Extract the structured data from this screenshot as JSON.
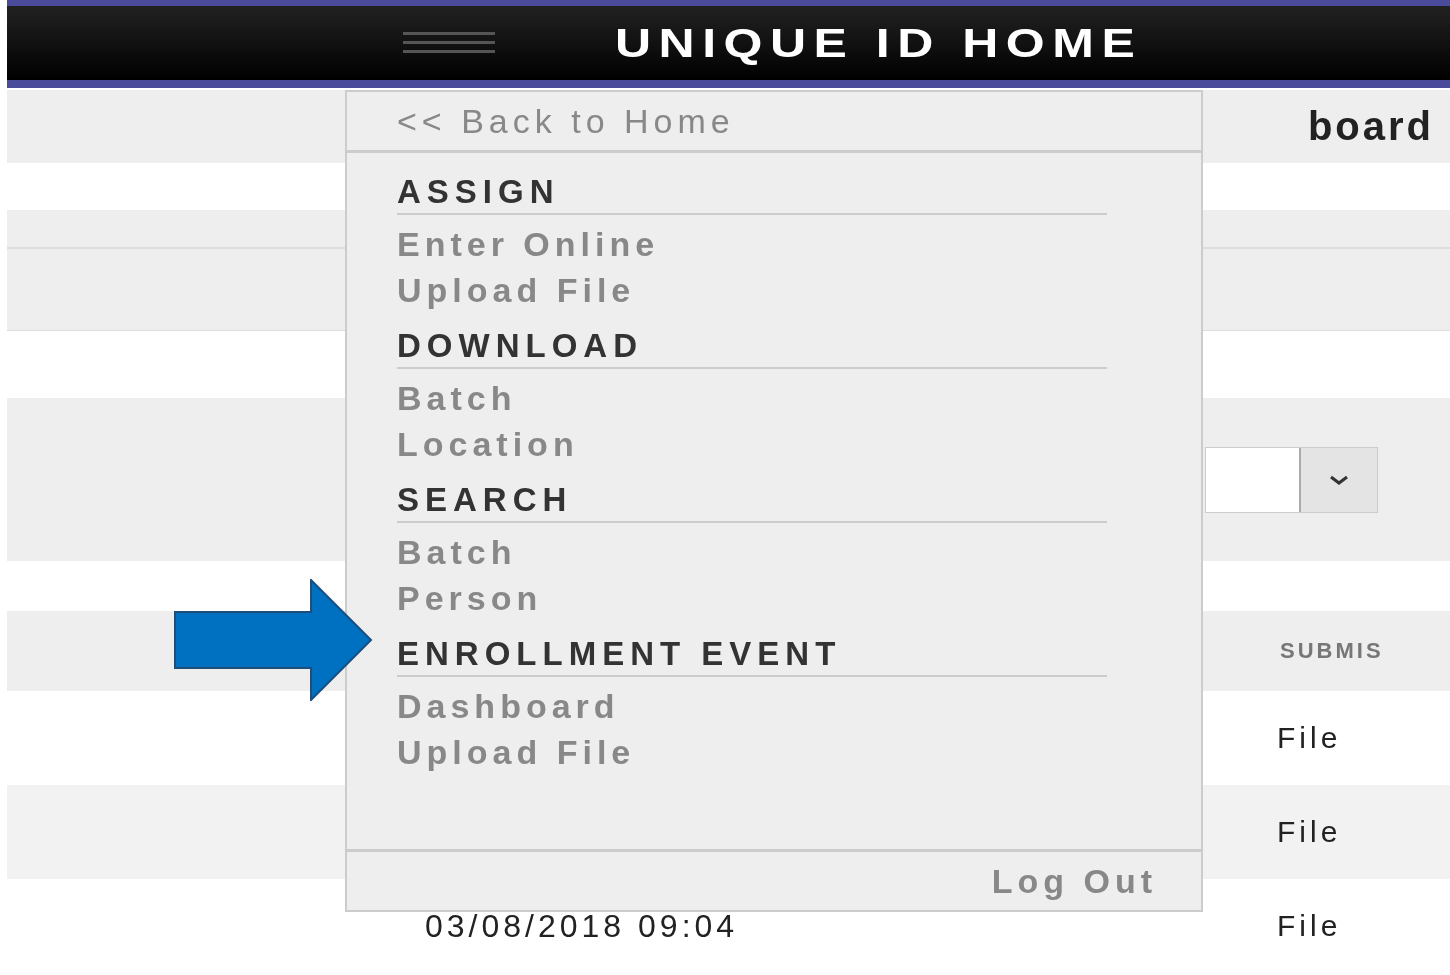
{
  "header": {
    "title": "UNIQUE ID HOME"
  },
  "page": {
    "heading": "board",
    "table_header": "SUBMIS",
    "rows": [
      {
        "type": "File"
      },
      {
        "type": "File"
      },
      {
        "date": "03/08/2018 09:04",
        "type": "File"
      }
    ]
  },
  "menu": {
    "back": "<< Back to Home",
    "sections": [
      {
        "title": "ASSIGN",
        "items": [
          "Enter Online",
          "Upload File"
        ]
      },
      {
        "title": "DOWNLOAD",
        "items": [
          "Batch",
          "Location"
        ]
      },
      {
        "title": "SEARCH",
        "items": [
          "Batch",
          "Person"
        ]
      },
      {
        "title": "ENROLLMENT EVENT",
        "items": [
          "Dashboard",
          "Upload File"
        ]
      }
    ],
    "logout": "Log Out"
  }
}
